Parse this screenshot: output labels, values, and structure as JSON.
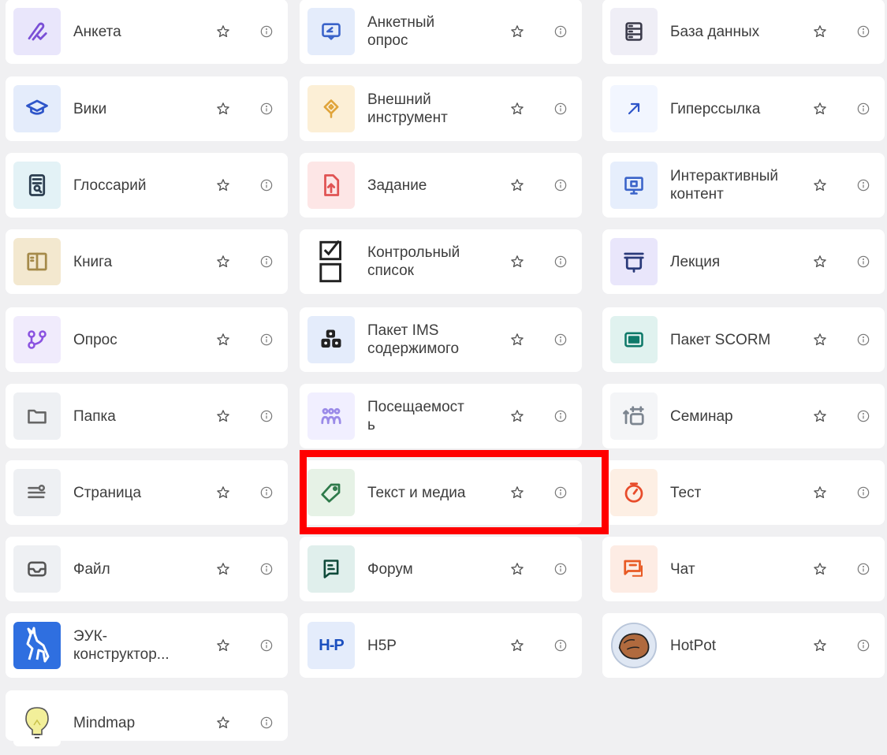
{
  "activities": [
    {
      "label": "Анкета",
      "icon": "pen-check-icon",
      "bg": "#e9e6fb",
      "color": "#7a4fd6"
    },
    {
      "label": "Анкетный\nопрос",
      "icon": "feedback-icon",
      "bg": "#e4ecfb",
      "color": "#3a63c9"
    },
    {
      "label": "База данных",
      "icon": "database-icon",
      "bg": "#efeef6",
      "color": "#3a3a4a"
    },
    {
      "label": "Вики",
      "icon": "graduation-cap-icon",
      "bg": "#e4ecfb",
      "color": "#2e55c9"
    },
    {
      "label": "Внешний\nинструмент",
      "icon": "puzzle-icon",
      "bg": "#fcefd6",
      "color": "#e0a43a"
    },
    {
      "label": "Гиперссылка",
      "icon": "arrow-up-right-icon",
      "bg": "#f2f6ff",
      "color": "#2e55c9"
    },
    {
      "label": "Глоссарий",
      "icon": "glossary-icon",
      "bg": "#e3f2f6",
      "color": "#2c3e50"
    },
    {
      "label": "Задание",
      "icon": "file-upload-icon",
      "bg": "#fde6e6",
      "color": "#e05353"
    },
    {
      "label": "Интерактивный\nконтент",
      "icon": "monitor-icon",
      "bg": "#e6eefc",
      "color": "#3a63c9"
    },
    {
      "label": "Книга",
      "icon": "book-icon",
      "bg": "#f3e8cf",
      "color": "#a58a4a"
    },
    {
      "label": "Контрольный\nсписок",
      "icon": "checklist-icon",
      "bg": "#ffffff",
      "color": "#222222"
    },
    {
      "label": "Лекция",
      "icon": "lecture-icon",
      "bg": "#e9e6fb",
      "color": "#2a3a7a"
    },
    {
      "label": "Опрос",
      "icon": "poll-icon",
      "bg": "#f0ebfc",
      "color": "#8a52e0"
    },
    {
      "label": "Пакет IMS\nсодержимого",
      "icon": "package-icon",
      "bg": "#e4ecfb",
      "color": "#222222"
    },
    {
      "label": "Пакет SCORM",
      "icon": "scorm-icon",
      "bg": "#e0f2ef",
      "color": "#0f7a6a"
    },
    {
      "label": "Папка",
      "icon": "folder-icon",
      "bg": "#eef0f3",
      "color": "#666666"
    },
    {
      "label": "Посещаемост\nь",
      "icon": "attendance-icon",
      "bg": "#f1efff",
      "color": "#9a8ae8"
    },
    {
      "label": "Семинар",
      "icon": "workshop-icon",
      "bg": "#f4f5f7",
      "color": "#7c8590"
    },
    {
      "label": "Страница",
      "icon": "page-icon",
      "bg": "#eef0f3",
      "color": "#666666"
    },
    {
      "label": "Текст и медиа",
      "icon": "tag-icon",
      "bg": "#e6f2e6",
      "color": "#2e7a4a"
    },
    {
      "label": "Тест",
      "icon": "timer-icon",
      "bg": "#fdefe4",
      "color": "#e84c2b"
    },
    {
      "label": "Файл",
      "icon": "inbox-icon",
      "bg": "#eef0f3",
      "color": "#555555"
    },
    {
      "label": "Форум",
      "icon": "forum-icon",
      "bg": "#e0efec",
      "color": "#0f4a3a"
    },
    {
      "label": "Чат",
      "icon": "chat-icon",
      "bg": "#fdece4",
      "color": "#e85a24"
    },
    {
      "label": "ЭУК-\nконструктор...",
      "icon": "deer-logo-icon",
      "bg": "#2f6fe0",
      "color": "#ffffff"
    },
    {
      "label": "H5P",
      "icon": "h5p-logo-icon",
      "bg": "#e4ecfb",
      "color": "#1b4fbf",
      "logo_text": "H-P"
    },
    {
      "label": "HotPot",
      "icon": "hotpot-logo-icon",
      "bg": "#ffffff",
      "color": "#a0603a"
    },
    {
      "label": "Mindmap",
      "icon": "lightbulb-icon",
      "bg": "#ffffff",
      "color": "#c8c24a"
    }
  ],
  "highlighted": "Текст и медиа",
  "colors": {
    "highlight": "#ff0000",
    "page_bg": "#f0f0f2",
    "card_bg": "#ffffff",
    "icon_grey": "#7a7a7a"
  }
}
